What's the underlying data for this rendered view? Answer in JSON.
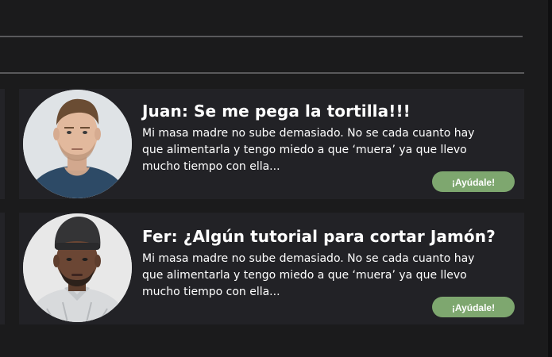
{
  "posts": [
    {
      "author": "Juan",
      "title": "Juan: Se me pega la tortilla!!!",
      "body": "Mi masa madre no sube demasiado. No se cada cuanto hay que alimentarla y tengo miedo a que ‘muera’ ya que llevo mucho tiempo con ella...",
      "button_label": "¡Ayúdale!"
    },
    {
      "author": "Fer",
      "title": "Fer: ¿Algún tutorial para cortar Jamón?",
      "body": "Mi masa madre no sube demasiado. No se cada cuanto hay que alimentarla y tengo miedo a que ‘muera’ ya que llevo mucho tiempo con ella...",
      "button_label": "¡Ayúdale!"
    }
  ],
  "colors": {
    "page_background": "#1b1b1c",
    "card_background": "#222226",
    "divider": "#59595b",
    "button_background": "#7ea76f",
    "text": "#ffffff"
  }
}
